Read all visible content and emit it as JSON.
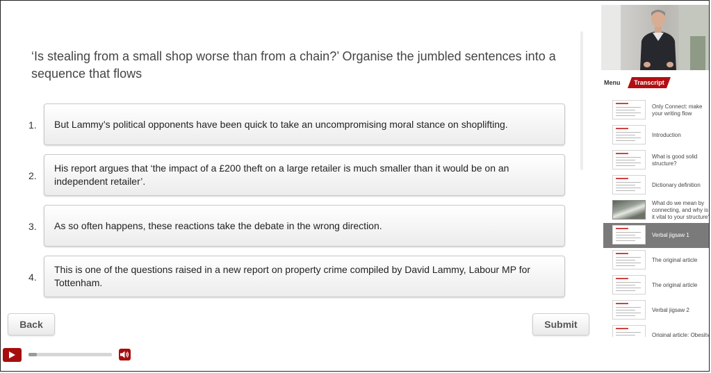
{
  "question": "‘Is stealing from a small shop worse than from a chain?’ Organise the jumbled sentences into a sequence that flows",
  "items": [
    {
      "num": "1.",
      "text": "But Lammy’s political opponents have been quick to take an uncompromising moral stance on shoplifting."
    },
    {
      "num": "2.",
      "text": "His report argues that ‘the impact of a £200 theft on a large retailer is much smaller than it would be on an independent retailer’."
    },
    {
      "num": "3.",
      "text": "As so often happens, these reactions take the debate in the wrong direction."
    },
    {
      "num": "4.",
      "text": "This is one of the questions raised in a new report on property crime compiled by David Lammy, Labour MP for Tottenham."
    }
  ],
  "buttons": {
    "back": "Back",
    "submit": "Submit"
  },
  "player": {
    "progress": 0.1,
    "play_icon": "play-icon",
    "volume_icon": "volume-icon"
  },
  "sidebar": {
    "tabs": {
      "menu": "Menu",
      "transcript": "Transcript"
    },
    "active_index": 5,
    "items": [
      {
        "label": "Only Connect: make your writing flow",
        "thumb": "text"
      },
      {
        "label": "Introduction",
        "thumb": "text"
      },
      {
        "label": "What is good solid structure?",
        "thumb": "text"
      },
      {
        "label": "Dictionary definition",
        "thumb": "text"
      },
      {
        "label": "What do we mean by connecting, and why is it vital to your structure?",
        "thumb": "photo"
      },
      {
        "label": "Verbal jigsaw 1",
        "thumb": "text"
      },
      {
        "label": "The original article",
        "thumb": "text"
      },
      {
        "label": "The original article",
        "thumb": "text"
      },
      {
        "label": "Verbal jigsaw 2",
        "thumb": "text"
      },
      {
        "label": "Original article: Obesity",
        "thumb": "text"
      }
    ]
  },
  "colors": {
    "accent": "#b30f13",
    "active_row": "#7a7a7a"
  }
}
